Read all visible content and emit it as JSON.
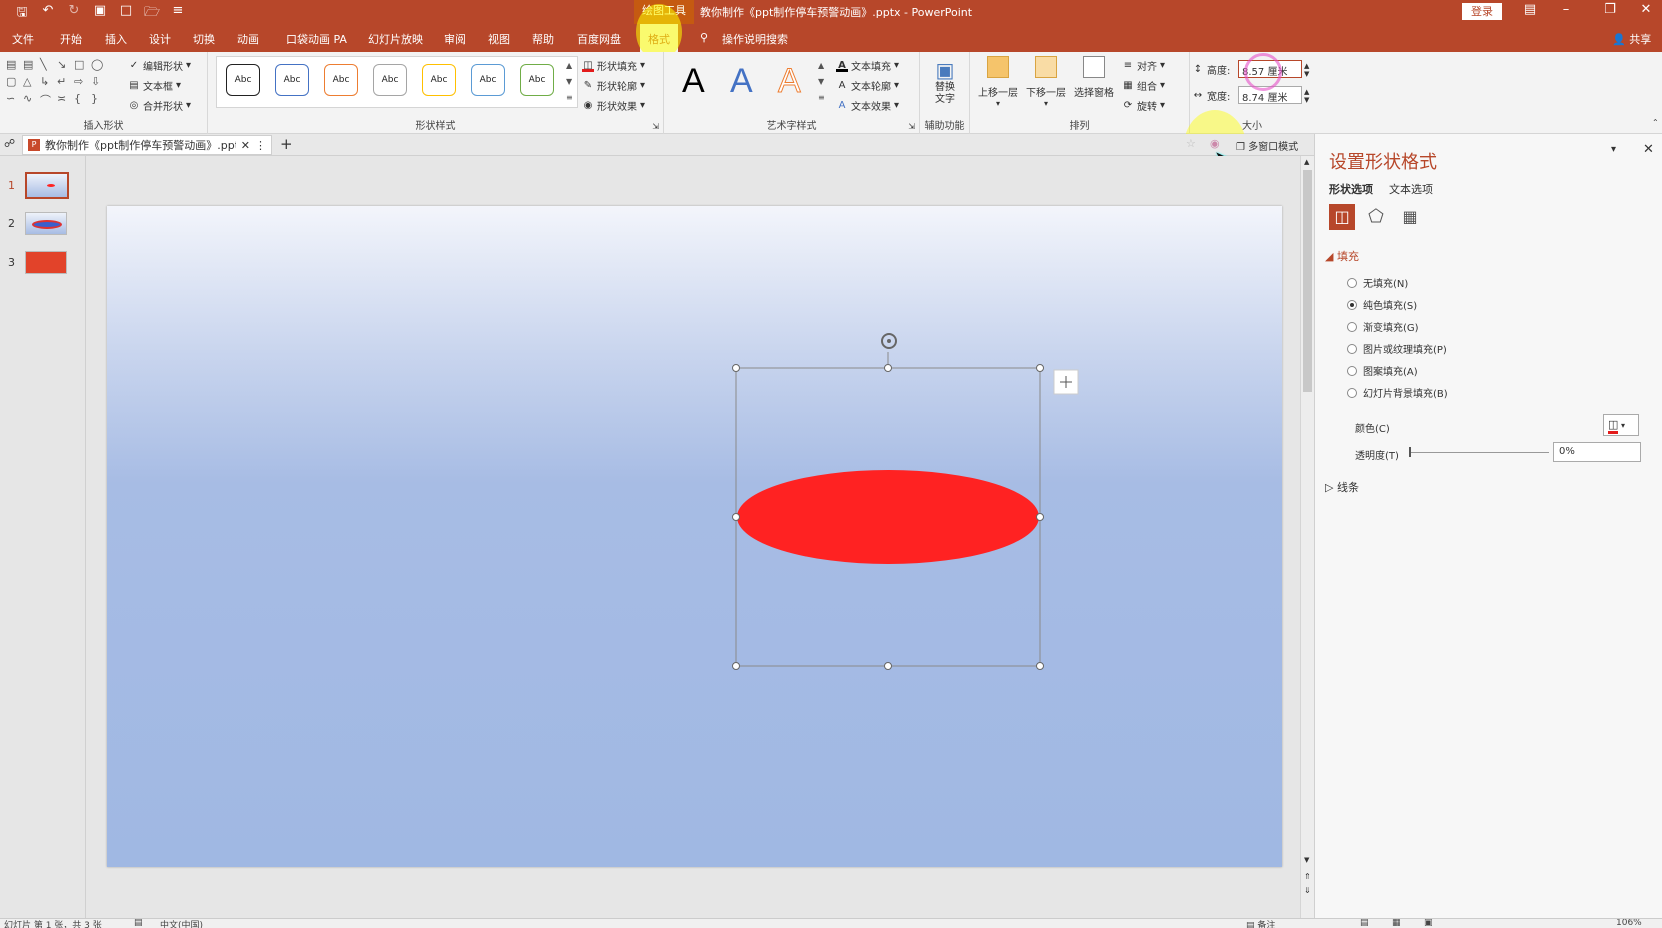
{
  "titlebar": {
    "context_tools": "绘图工具",
    "doc_title": "教你制作《ppt制作停车预警动画》.pptx  -  PowerPoint",
    "login": "登录"
  },
  "menu": {
    "tabs": [
      "文件",
      "开始",
      "插入",
      "设计",
      "切换",
      "动画",
      "口袋动画 PA",
      "幻灯片放映",
      "审阅",
      "视图",
      "帮助",
      "百度网盘",
      "格式"
    ],
    "active": "格式",
    "tell_me": "操作说明搜索",
    "share": "共享"
  },
  "ribbon": {
    "insert_shapes": {
      "label": "插入形状",
      "edit_shape": "编辑形状",
      "text_box": "文本框",
      "merge_shapes": "合并形状"
    },
    "shape_styles": {
      "label": "形状样式",
      "preset_text": "Abc",
      "preset_colors": [
        "#222222",
        "#4472c4",
        "#ed7d31",
        "#a5a5a5",
        "#ffc000",
        "#5b9bd5",
        "#70ad47"
      ],
      "fill": "形状填充",
      "outline": "形状轮廓",
      "effects": "形状效果"
    },
    "wordart": {
      "label": "艺术字样式",
      "glyph": "A",
      "text_fill": "文本填充",
      "text_outline": "文本轮廓",
      "text_effects": "文本效果"
    },
    "accessibility": {
      "label": "辅助功能",
      "alt_text_line1": "替换",
      "alt_text_line2": "文字"
    },
    "arrange": {
      "label": "排列",
      "bring_forward": "上移一层",
      "send_backward": "下移一层",
      "selection_pane": "选择窗格",
      "align": "对齐",
      "group": "组合",
      "rotate": "旋转"
    },
    "size": {
      "label": "大小",
      "height_label": "高度:",
      "height_value": "8.57 厘米",
      "width_label": "宽度:",
      "width_value": "8.74 厘米"
    }
  },
  "docbar": {
    "file_tab": "教你制作《ppt制作停车预警动画》.pptx",
    "multi_window": "多窗口模式"
  },
  "thumbnails": [
    {
      "number": "1",
      "selected": true
    },
    {
      "number": "2",
      "selected": false
    },
    {
      "number": "3",
      "selected": false
    }
  ],
  "shape": {
    "fill_color": "#ff2222"
  },
  "pane": {
    "title": "设置形状格式",
    "tab_shape": "形状选项",
    "tab_text": "文本选项",
    "fill_section": "填充",
    "options": [
      {
        "label": "无填充(N)",
        "checked": false
      },
      {
        "label": "纯色填充(S)",
        "checked": true
      },
      {
        "label": "渐变填充(G)",
        "checked": false
      },
      {
        "label": "图片或纹理填充(P)",
        "checked": false
      },
      {
        "label": "图案填充(A)",
        "checked": false
      },
      {
        "label": "幻灯片背景填充(B)",
        "checked": false
      }
    ],
    "color_label": "颜色(C)",
    "transparency_label": "透明度(T)",
    "transparency_value": "0%",
    "line_section": "线条"
  },
  "status": {
    "slide_info": "幻灯片 第 1 张，共 3 张",
    "language": "中文(中国)",
    "notes": "备注",
    "zoom": "106%"
  }
}
